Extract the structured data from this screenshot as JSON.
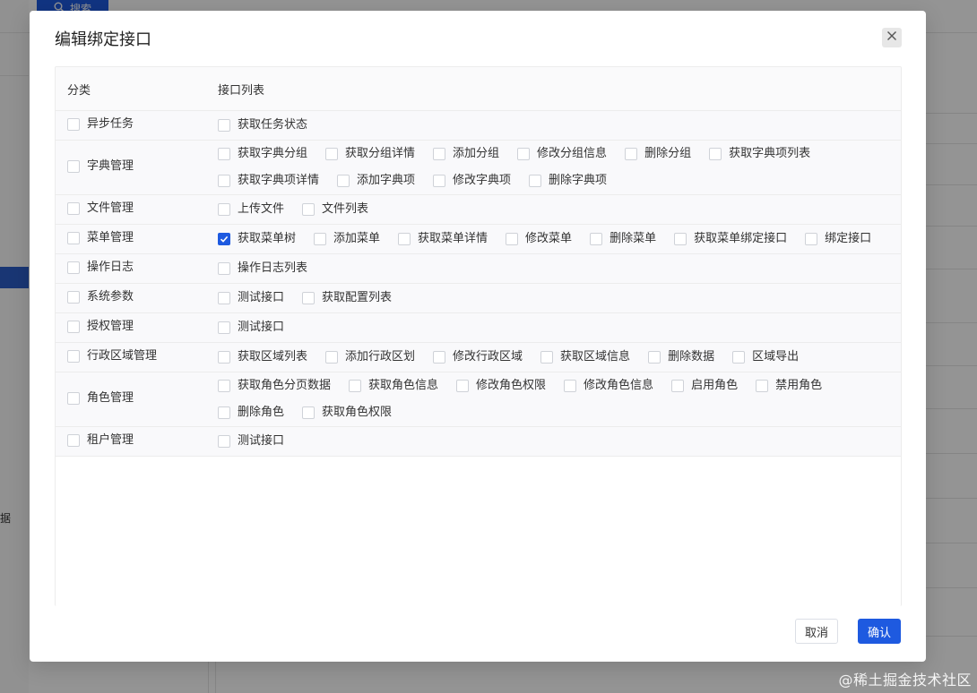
{
  "background": {
    "top_button_label": "搜索",
    "left_char": "据"
  },
  "watermark": "@稀土掘金技术社区",
  "modal": {
    "title": "编辑绑定接口",
    "table": {
      "headers": {
        "category": "分类",
        "api_list": "接口列表"
      },
      "rows": [
        {
          "category": "异步任务",
          "checked": false,
          "apis": [
            {
              "label": "获取任务状态",
              "checked": false
            }
          ]
        },
        {
          "category": "字典管理",
          "checked": false,
          "apis": [
            {
              "label": "获取字典分组",
              "checked": false
            },
            {
              "label": "获取分组详情",
              "checked": false
            },
            {
              "label": "添加分组",
              "checked": false
            },
            {
              "label": "修改分组信息",
              "checked": false
            },
            {
              "label": "删除分组",
              "checked": false
            },
            {
              "label": "获取字典项列表",
              "checked": false
            },
            {
              "label": "获取字典项详情",
              "checked": false
            },
            {
              "label": "添加字典项",
              "checked": false
            },
            {
              "label": "修改字典项",
              "checked": false
            },
            {
              "label": "删除字典项",
              "checked": false
            }
          ]
        },
        {
          "category": "文件管理",
          "checked": false,
          "apis": [
            {
              "label": "上传文件",
              "checked": false
            },
            {
              "label": "文件列表",
              "checked": false
            }
          ]
        },
        {
          "category": "菜单管理",
          "checked": false,
          "apis": [
            {
              "label": "获取菜单树",
              "checked": true
            },
            {
              "label": "添加菜单",
              "checked": false
            },
            {
              "label": "获取菜单详情",
              "checked": false
            },
            {
              "label": "修改菜单",
              "checked": false
            },
            {
              "label": "删除菜单",
              "checked": false
            },
            {
              "label": "获取菜单绑定接口",
              "checked": false
            },
            {
              "label": "绑定接口",
              "checked": false
            }
          ]
        },
        {
          "category": "操作日志",
          "checked": false,
          "apis": [
            {
              "label": "操作日志列表",
              "checked": false
            }
          ]
        },
        {
          "category": "系统参数",
          "checked": false,
          "apis": [
            {
              "label": "测试接口",
              "checked": false
            },
            {
              "label": "获取配置列表",
              "checked": false
            }
          ]
        },
        {
          "category": "授权管理",
          "checked": false,
          "apis": [
            {
              "label": "测试接口",
              "checked": false
            }
          ]
        },
        {
          "category": "行政区域管理",
          "checked": false,
          "apis": [
            {
              "label": "获取区域列表",
              "checked": false
            },
            {
              "label": "添加行政区划",
              "checked": false
            },
            {
              "label": "修改行政区域",
              "checked": false
            },
            {
              "label": "获取区域信息",
              "checked": false
            },
            {
              "label": "删除数据",
              "checked": false
            },
            {
              "label": "区域导出",
              "checked": false
            }
          ]
        },
        {
          "category": "角色管理",
          "checked": false,
          "apis": [
            {
              "label": "获取角色分页数据",
              "checked": false
            },
            {
              "label": "获取角色信息",
              "checked": false
            },
            {
              "label": "修改角色权限",
              "checked": false
            },
            {
              "label": "修改角色信息",
              "checked": false
            },
            {
              "label": "启用角色",
              "checked": false
            },
            {
              "label": "禁用角色",
              "checked": false
            },
            {
              "label": "删除角色",
              "checked": false
            },
            {
              "label": "获取角色权限",
              "checked": false
            }
          ]
        },
        {
          "category": "租户管理",
          "checked": false,
          "apis": [
            {
              "label": "测试接口",
              "checked": false
            }
          ]
        }
      ]
    },
    "footer": {
      "cancel_label": "取消",
      "confirm_label": "确认"
    }
  },
  "colors": {
    "primary": "#1e5ae0",
    "overlay": "rgba(0,0,0,0.42)",
    "row_bg": "#f9f9fb",
    "border": "#ececec"
  },
  "icons": {
    "close": "close-icon",
    "search": "search-icon",
    "check": "check-icon"
  }
}
